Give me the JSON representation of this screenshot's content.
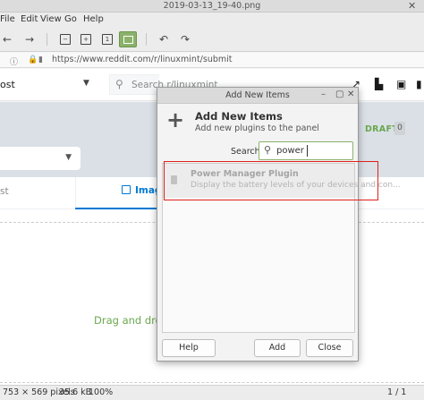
{
  "viewer": {
    "title": "2019-03-13_19-40.png",
    "menu": [
      "File",
      "Edit",
      "View",
      "Go",
      "Help"
    ],
    "status": {
      "dimensions": "753 × 569 pixels",
      "size": "35.6 kB",
      "zoom": "100%",
      "page": "1 / 1"
    }
  },
  "browser": {
    "url": "https://www.reddit.com/r/linuxmint/submit"
  },
  "reddit": {
    "sort_label": "ost",
    "search_placeholder": "Search r/linuxmint",
    "drafts_label": "DRAFTS",
    "drafts_count": "0",
    "tab_post": "st",
    "tab_image": "Imag",
    "drop_text": "Drag and drop"
  },
  "dialog": {
    "title": "Add New Items",
    "heading": "Add New Items",
    "subheading": "Add new plugins to the panel",
    "search_label": "Search:",
    "search_value": "power",
    "items": [
      {
        "name": "Power Manager Plugin",
        "description": "Display the battery levels of your devices and con..."
      }
    ],
    "buttons": {
      "help": "Help",
      "add": "Add",
      "close": "Close"
    }
  },
  "colors": {
    "accent_green": "#8ab26a",
    "reddit_blue": "#0079d3",
    "highlight_red": "#e0201a"
  }
}
